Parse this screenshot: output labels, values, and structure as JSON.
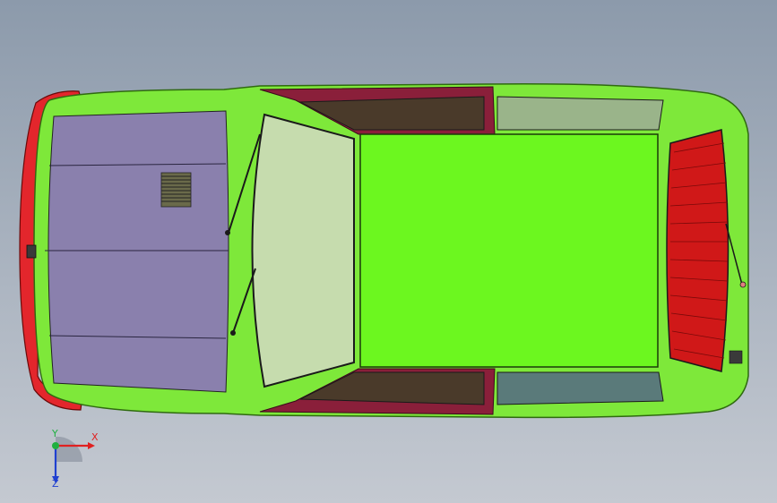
{
  "viewport": {
    "background_top": "#8c9aab",
    "background_bottom": "#c4c9d1"
  },
  "model": {
    "body_color": "#7ee83a",
    "body_edge_color": "#2f6a10",
    "roof_color": "#6cf71f",
    "hood_color": "#8a80ad",
    "glass_color": "#c6dcae",
    "door_glass_color": "#4a3a2a",
    "door_trim_color": "#8a1f3a",
    "bumper_color": "#e3262c",
    "taillight_color": "#d01818"
  },
  "triad": {
    "x_label": "X",
    "y_label": "Y",
    "z_label": "Z",
    "x_color": "#e02020",
    "y_color": "#20b040",
    "z_color": "#2040d0"
  }
}
